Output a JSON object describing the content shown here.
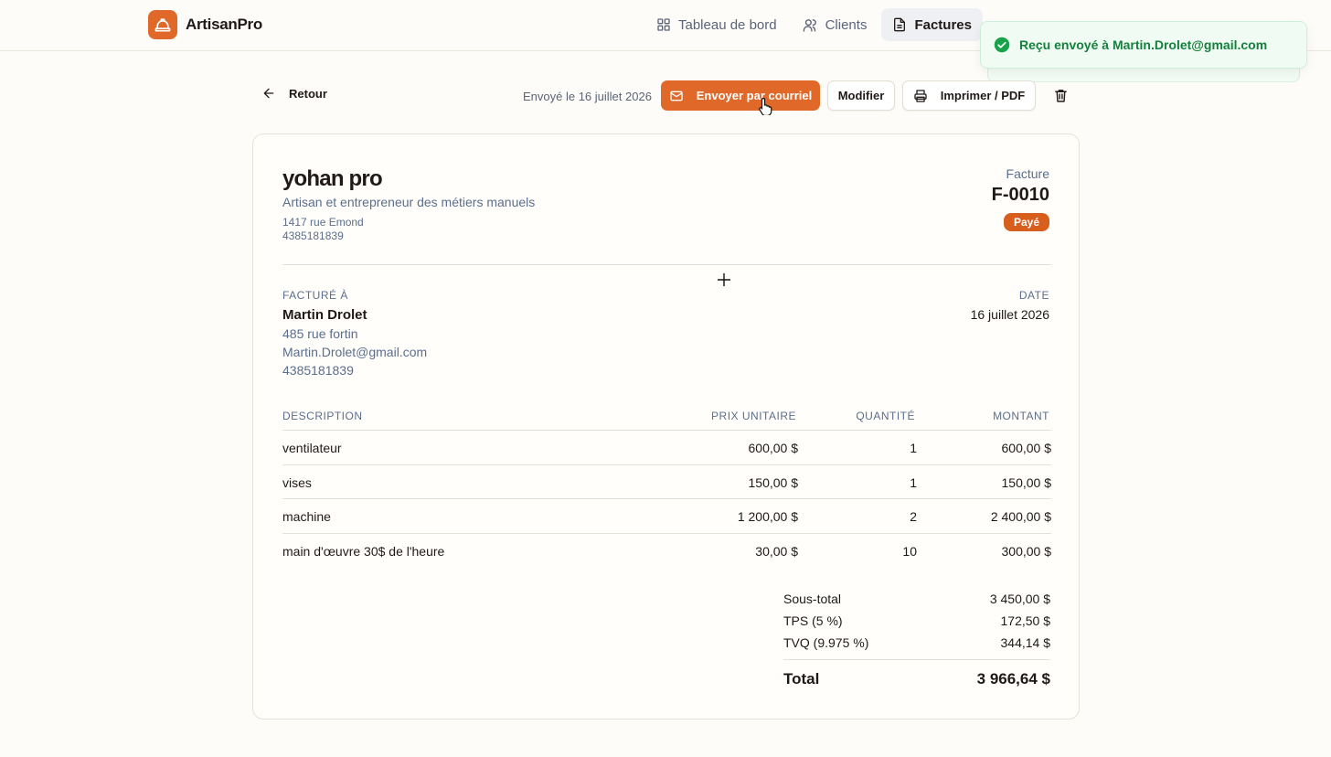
{
  "app": {
    "name": "ArtisanPro"
  },
  "nav": {
    "items": [
      {
        "label": "Tableau de bord",
        "icon": "grid-icon",
        "active": false
      },
      {
        "label": "Clients",
        "icon": "users-icon",
        "active": false
      },
      {
        "label": "Factures",
        "icon": "file-icon",
        "active": true
      }
    ]
  },
  "toast": {
    "message": "Reçu envoyé à Martin.Drolet@gmail.com"
  },
  "actions": {
    "back_label": "Retour",
    "sent_status": "Envoyé le 16 juillet 2026",
    "send_email_label": "Envoyer par courriel",
    "edit_label": "Modifier",
    "print_label": "Imprimer / PDF"
  },
  "business": {
    "name": "yohan pro",
    "tagline": "Artisan et entrepreneur des métiers manuels",
    "address": "1417 rue Emond",
    "phone": "4385181839"
  },
  "invoice": {
    "type_label": "Facture",
    "number": "F-0010",
    "status": "Payé",
    "billed_to_label": "FACTURÉ À",
    "date_label": "DATE",
    "date": "16 juillet 2026"
  },
  "client": {
    "name": "Martin Drolet",
    "address": "485 rue fortin",
    "email": "Martin.Drolet@gmail.com",
    "phone": "4385181839"
  },
  "table": {
    "headers": {
      "description": "DESCRIPTION",
      "unit_price": "PRIX UNITAIRE",
      "quantity": "QUANTITÉ",
      "amount": "MONTANT"
    },
    "rows": [
      {
        "description": "ventilateur",
        "unit_price": "600,00 $",
        "quantity": "1",
        "amount": "600,00 $"
      },
      {
        "description": "vises",
        "unit_price": "150,00 $",
        "quantity": "1",
        "amount": "150,00 $"
      },
      {
        "description": "machine",
        "unit_price": "1 200,00 $",
        "quantity": "2",
        "amount": "2 400,00 $"
      },
      {
        "description": "main d'œuvre 30$ de l'heure",
        "unit_price": "30,00 $",
        "quantity": "10",
        "amount": "300,00 $"
      }
    ]
  },
  "totals": {
    "subtotal_label": "Sous-total",
    "subtotal": "3 450,00 $",
    "tps_label": "TPS (5 %)",
    "tps": "172,50 $",
    "tvq_label": "TVQ (9.975 %)",
    "tvq": "344,14 $",
    "total_label": "Total",
    "total": "3 966,64 $"
  },
  "colors": {
    "accent": "#e0692a",
    "badge": "#d85e1e",
    "success": "#15803d",
    "muted": "#5b6e8c"
  }
}
